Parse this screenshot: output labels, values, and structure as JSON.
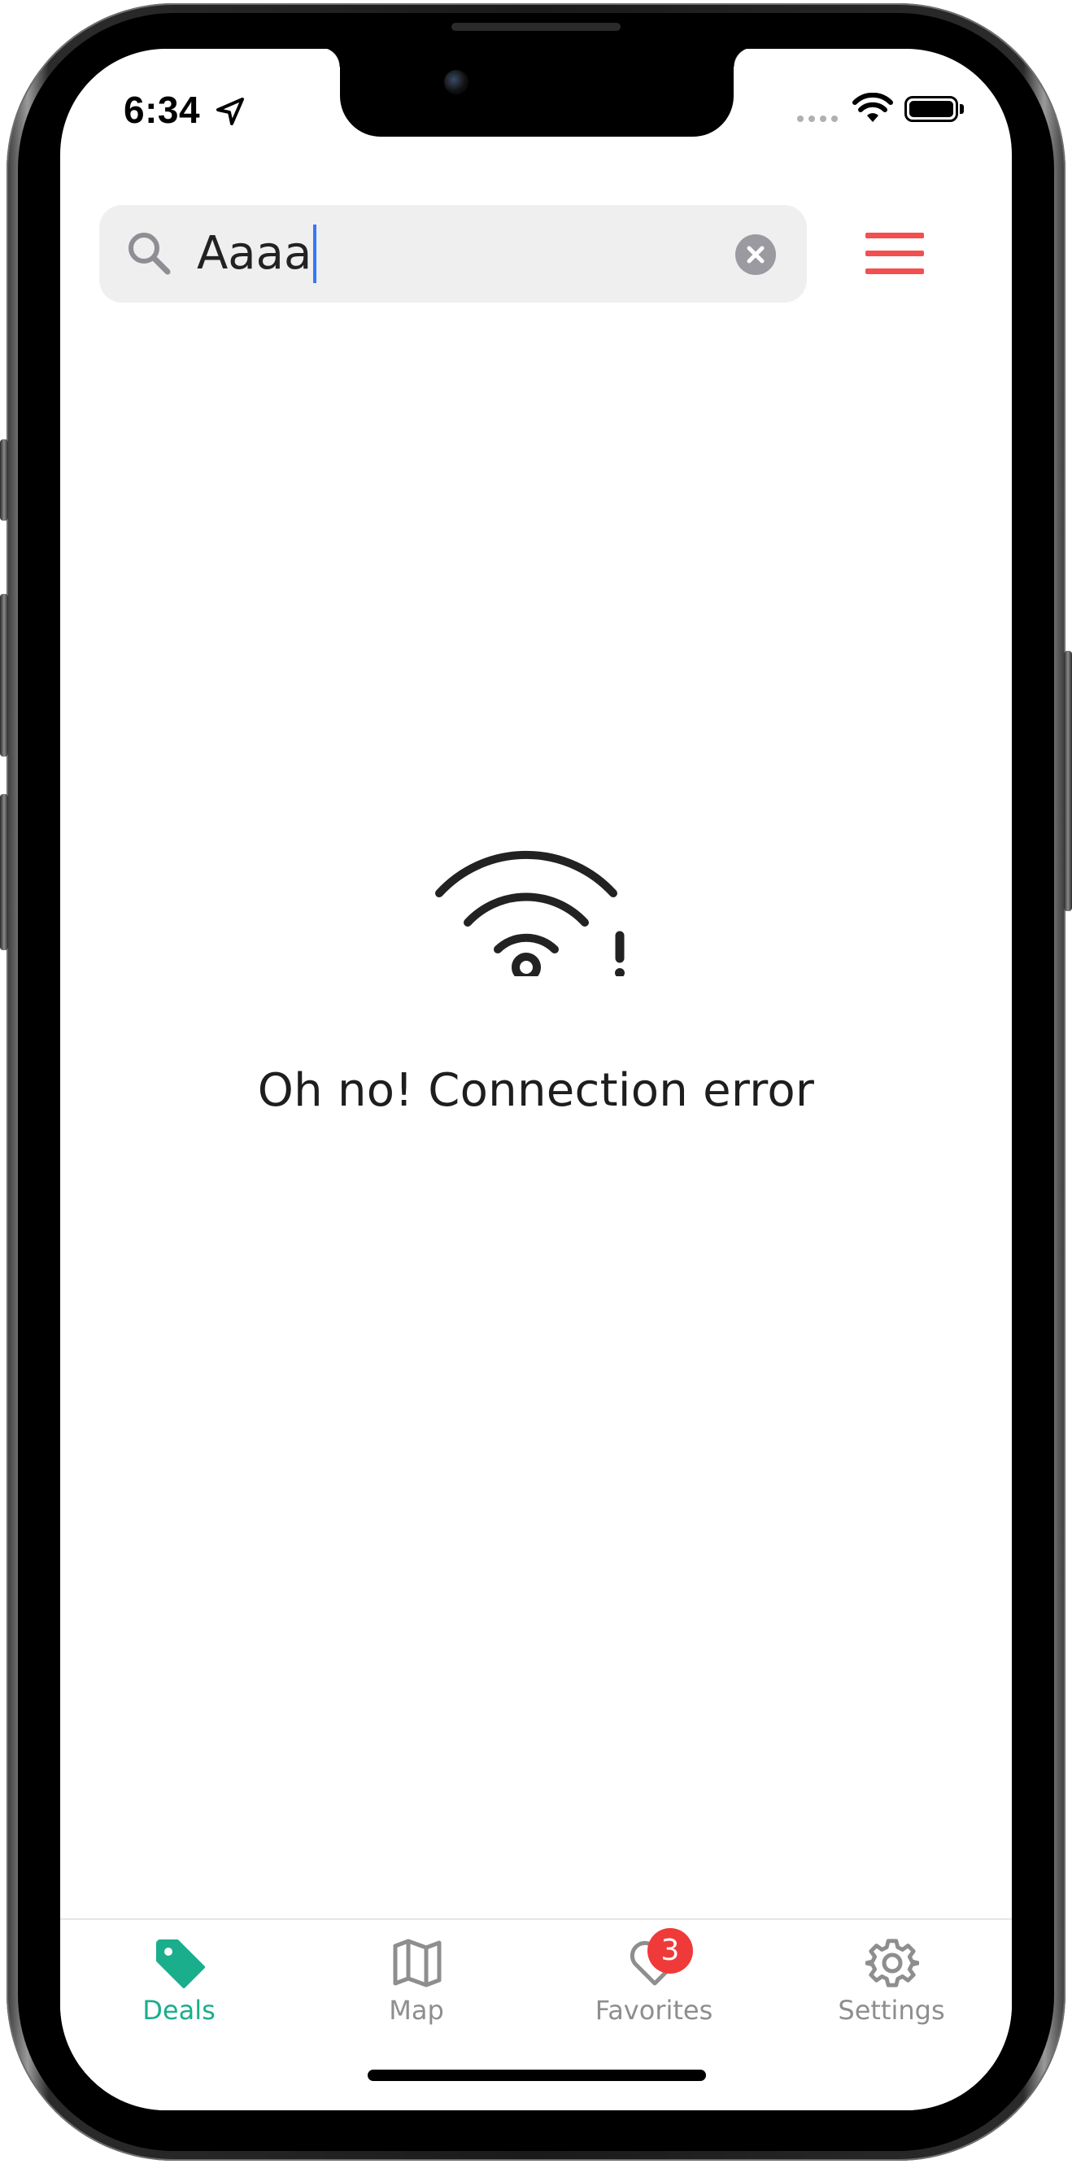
{
  "status_bar": {
    "time": "6:34",
    "location_icon": "location-arrow-icon",
    "wifi_icon": "wifi-icon",
    "battery_icon": "battery-icon"
  },
  "search": {
    "value": "Aaaa",
    "icon": "search-icon",
    "clear_icon": "clear-icon"
  },
  "menu": {
    "icon": "hamburger-menu-icon",
    "color": "#f44f4f"
  },
  "error": {
    "icon": "wifi-error-icon",
    "message": "Oh no! Connection error"
  },
  "tab_bar": {
    "active_color": "#1aae8c",
    "inactive_color": "#8e8e8e",
    "tabs": [
      {
        "label": "Deals",
        "icon": "tag-icon",
        "active": true
      },
      {
        "label": "Map",
        "icon": "map-icon",
        "active": false
      },
      {
        "label": "Favorites",
        "icon": "heart-icon",
        "active": false,
        "badge": "3"
      },
      {
        "label": "Settings",
        "icon": "gear-icon",
        "active": false
      }
    ]
  }
}
